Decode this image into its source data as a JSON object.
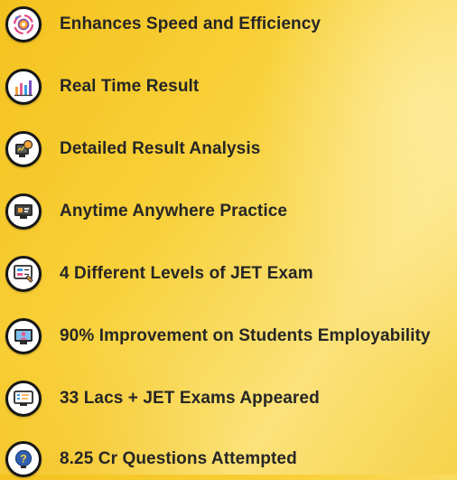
{
  "features": [
    {
      "label": "Enhances Speed and Efficiency",
      "icon": "speed-gear-icon"
    },
    {
      "label": "Real Time Result",
      "icon": "bar-chart-icon"
    },
    {
      "label": "Detailed Result Analysis",
      "icon": "analysis-monitor-icon"
    },
    {
      "label": "Anytime Anywhere Practice",
      "icon": "computer-practice-icon"
    },
    {
      "label": "4 Different Levels of JET Exam",
      "icon": "exam-screen-icon"
    },
    {
      "label": "90% Improvement on Students Employability",
      "icon": "student-monitor-icon"
    },
    {
      "label": "33 Lacs + JET Exams Appeared",
      "icon": "exam-document-icon"
    },
    {
      "label": "8.25 Cr Questions Attempted",
      "icon": "question-bulb-icon"
    }
  ],
  "colors": {
    "background": "#f8d038",
    "text": "#262626",
    "icon_border": "#161616"
  }
}
